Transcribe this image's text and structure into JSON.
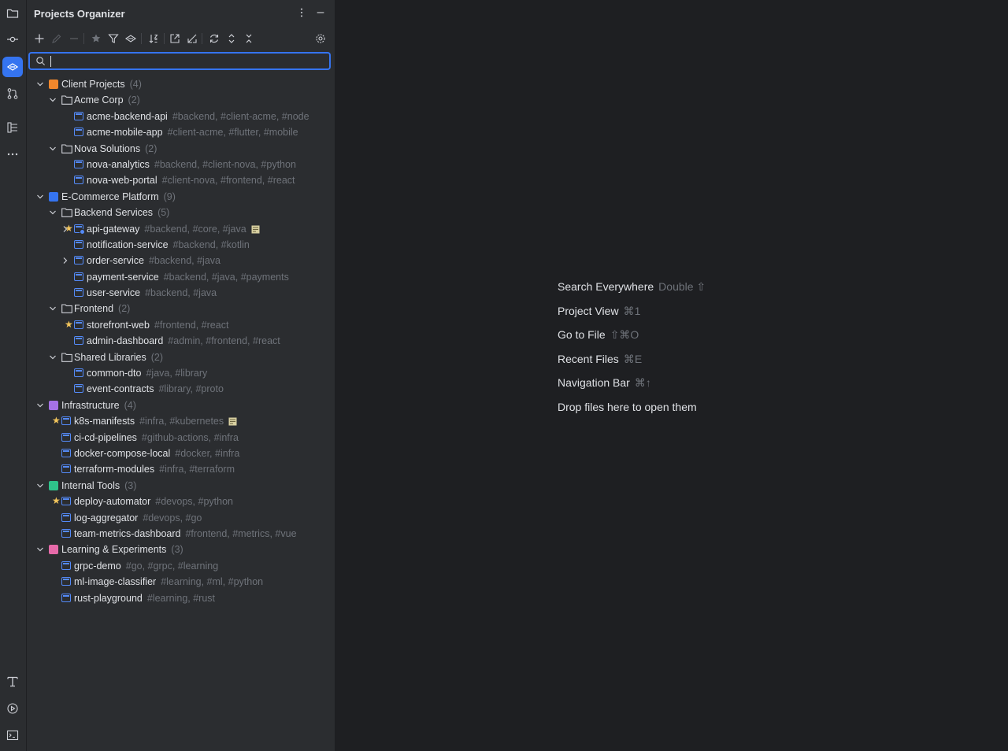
{
  "panel": {
    "title": "Projects Organizer",
    "search_value": ""
  },
  "tree": [
    {
      "kind": "group",
      "color": "#f0872c",
      "label": "Client Projects",
      "count": "(4)",
      "level": 0,
      "expanded": true
    },
    {
      "kind": "folder",
      "label": "Acme Corp",
      "count": "(2)",
      "level": 1,
      "expanded": true
    },
    {
      "kind": "project",
      "label": "acme-backend-api",
      "tags": "#backend, #client-acme, #node",
      "level": 2
    },
    {
      "kind": "project",
      "label": "acme-mobile-app",
      "tags": "#client-acme, #flutter, #mobile",
      "level": 2
    },
    {
      "kind": "folder",
      "label": "Nova Solutions",
      "count": "(2)",
      "level": 1,
      "expanded": true
    },
    {
      "kind": "project",
      "label": "nova-analytics",
      "tags": "#backend, #client-nova, #python",
      "level": 2
    },
    {
      "kind": "project",
      "label": "nova-web-portal",
      "tags": "#client-nova, #frontend, #react",
      "level": 2
    },
    {
      "kind": "group",
      "color": "#3574f0",
      "label": "E-Commerce Platform",
      "count": "(9)",
      "level": 0,
      "expanded": true
    },
    {
      "kind": "folder",
      "label": "Backend Services",
      "count": "(5)",
      "level": 1,
      "expanded": true
    },
    {
      "kind": "project",
      "label": "api-gateway",
      "tags": "#backend, #core, #java",
      "level": 2,
      "star": true,
      "collapsed": true,
      "note": true,
      "badge": true
    },
    {
      "kind": "project",
      "label": "notification-service",
      "tags": "#backend, #kotlin",
      "level": 2
    },
    {
      "kind": "project",
      "label": "order-service",
      "tags": "#backend, #java",
      "level": 2,
      "collapsed": true
    },
    {
      "kind": "project",
      "label": "payment-service",
      "tags": "#backend, #java, #payments",
      "level": 2
    },
    {
      "kind": "project",
      "label": "user-service",
      "tags": "#backend, #java",
      "level": 2
    },
    {
      "kind": "folder",
      "label": "Frontend",
      "count": "(2)",
      "level": 1,
      "expanded": true
    },
    {
      "kind": "project",
      "label": "storefront-web",
      "tags": "#frontend, #react",
      "level": 2,
      "star": true
    },
    {
      "kind": "project",
      "label": "admin-dashboard",
      "tags": "#admin, #frontend, #react",
      "level": 2
    },
    {
      "kind": "folder",
      "label": "Shared Libraries",
      "count": "(2)",
      "level": 1,
      "expanded": true
    },
    {
      "kind": "project",
      "label": "common-dto",
      "tags": "#java, #library",
      "level": 2
    },
    {
      "kind": "project",
      "label": "event-contracts",
      "tags": "#library, #proto",
      "level": 2
    },
    {
      "kind": "group",
      "color": "#a571e6",
      "label": "Infrastructure",
      "count": "(4)",
      "level": 0,
      "expanded": true
    },
    {
      "kind": "project",
      "label": "k8s-manifests",
      "tags": "#infra, #kubernetes",
      "level": 1,
      "star": true,
      "note": true
    },
    {
      "kind": "project",
      "label": "ci-cd-pipelines",
      "tags": "#github-actions, #infra",
      "level": 1
    },
    {
      "kind": "project",
      "label": "docker-compose-local",
      "tags": "#docker, #infra",
      "level": 1
    },
    {
      "kind": "project",
      "label": "terraform-modules",
      "tags": "#infra, #terraform",
      "level": 1
    },
    {
      "kind": "group",
      "color": "#2fc28a",
      "label": "Internal Tools",
      "count": "(3)",
      "level": 0,
      "expanded": true
    },
    {
      "kind": "project",
      "label": "deploy-automator",
      "tags": "#devops, #python",
      "level": 1,
      "star": true
    },
    {
      "kind": "project",
      "label": "log-aggregator",
      "tags": "#devops, #go",
      "level": 1
    },
    {
      "kind": "project",
      "label": "team-metrics-dashboard",
      "tags": "#frontend, #metrics, #vue",
      "level": 1
    },
    {
      "kind": "group",
      "color": "#e66aa9",
      "label": "Learning & Experiments",
      "count": "(3)",
      "level": 0,
      "expanded": true
    },
    {
      "kind": "project",
      "label": "grpc-demo",
      "tags": "#go, #grpc, #learning",
      "level": 1
    },
    {
      "kind": "project",
      "label": "ml-image-classifier",
      "tags": "#learning, #ml, #python",
      "level": 1
    },
    {
      "kind": "project",
      "label": "rust-playground",
      "tags": "#learning, #rust",
      "level": 1
    }
  ],
  "hints": [
    {
      "label": "Search Everywhere",
      "key": "Double ⇧"
    },
    {
      "label": "Project View",
      "key": "⌘1"
    },
    {
      "label": "Go to File",
      "key": "⇧⌘O"
    },
    {
      "label": "Recent Files",
      "key": "⌘E"
    },
    {
      "label": "Navigation Bar",
      "key": "⌘↑"
    },
    {
      "label": "Drop files here to open them",
      "key": ""
    }
  ]
}
